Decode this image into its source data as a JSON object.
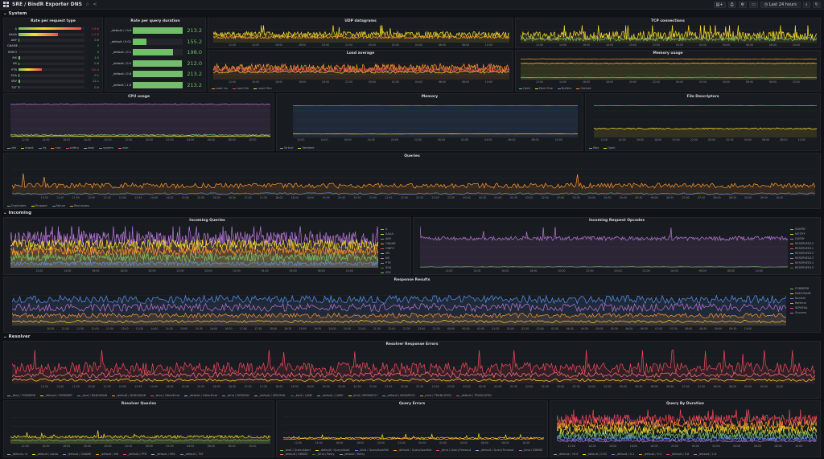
{
  "topbar": {
    "title": "SRE / BindR Exporter DNS",
    "time_range": "Last 24 hours",
    "buttons": [
      "add-panel",
      "save",
      "settings",
      "tv",
      "refresh"
    ]
  },
  "rows": {
    "system": "System",
    "incoming": "Incoming",
    "resolver": "Resolver"
  },
  "panels": {
    "rate_per_request_type": {
      "title": "Rate per request type",
      "items": [
        {
          "label": "A",
          "value": "1.6 K",
          "fraction": 0.95,
          "color": "#f2495c"
        },
        {
          "label": "AAAA",
          "value": "1.2 K",
          "fraction": 0.6,
          "color": "#f2495c"
        },
        {
          "label": "ANY",
          "value": "0.6",
          "fraction": 0.0,
          "color": "#73bf69"
        },
        {
          "label": "CNAME",
          "value": "0",
          "fraction": 0.0,
          "color": "#73bf69"
        },
        {
          "label": "HINFO",
          "value": "0",
          "fraction": 0.0,
          "color": "#73bf69"
        },
        {
          "label": "MX",
          "value": "3.5",
          "fraction": 0.02,
          "color": "#73bf69"
        },
        {
          "label": "NS",
          "value": "0.6",
          "fraction": 0.0,
          "color": "#73bf69"
        },
        {
          "label": "PTR",
          "value": "710.4",
          "fraction": 0.35,
          "color": "#f2495c"
        },
        {
          "label": "SOA",
          "value": "0.1",
          "fraction": 0.0,
          "color": "#73bf69"
        },
        {
          "label": "SRV",
          "value": "12.1",
          "fraction": 0.03,
          "color": "#73bf69"
        },
        {
          "label": "TXT",
          "value": "0.9",
          "fraction": 0.0,
          "color": "#73bf69"
        }
      ]
    },
    "rate_per_query_duration": {
      "title": "Rate per query duration",
      "items": [
        {
          "label": "_default / +Inf",
          "value": "213.2",
          "fraction": 1.0
        },
        {
          "label": "_default / 0.01",
          "value": "155.2",
          "fraction": 0.28
        },
        {
          "label": "_default / 0.1",
          "value": "198.0",
          "fraction": 0.8
        },
        {
          "label": "_default / 0.5",
          "value": "212.0",
          "fraction": 0.99
        },
        {
          "label": "_default / 0.8",
          "value": "213.2",
          "fraction": 1.0
        },
        {
          "label": "_default / 1.6",
          "value": "213.2",
          "fraction": 1.0
        }
      ]
    },
    "udp_datagrams": {
      "title": "UDP datagrams",
      "legend": []
    },
    "tcp_connections": {
      "title": "TCP connections",
      "legend": []
    },
    "load_average": {
      "title": "Load average",
      "legend": [
        "Load 1m",
        "Load 5m",
        "Load 15m"
      ]
    },
    "memory_usage": {
      "title": "Memory usage",
      "legend": [
        "Used",
        "Mem Free",
        "Buffers",
        "Cached"
      ]
    },
    "cpu_usage": {
      "title": "CPU usage",
      "legend": [
        "idle",
        "iowait",
        "irq",
        "nice",
        "softirq",
        "steal",
        "system",
        "user"
      ]
    },
    "memory": {
      "title": "Memory",
      "legend": [
        "Virtual",
        "Resident"
      ]
    },
    "file_descriptors": {
      "title": "File Descriptors",
      "legend": [
        "Max",
        "Open"
      ]
    },
    "queries": {
      "title": "Queries",
      "legend": [
        "Duplicates",
        "Dropped",
        "Failure",
        "Recursions"
      ]
    },
    "incoming_queries": {
      "title": "Incoming Queries",
      "legend": [
        "A",
        "AAAA",
        "ANY",
        "CNAME",
        "HINFO",
        "MX",
        "NS",
        "PTR",
        "SOA",
        "SRV",
        "TXT"
      ]
    },
    "incoming_request_opcodes": {
      "title": "Incoming Request Opcodes",
      "legend": [
        "IQUERY",
        "NOTIFY",
        "QUERY",
        "RESERVED10",
        "RESERVED11",
        "RESERVED12",
        "RESERVED13",
        "RESERVED14",
        "RESERVED15"
      ]
    },
    "response_results": {
      "title": "Response Results",
      "legend": [
        "FORMERR",
        "NXDOMAIN",
        "Nxrrset",
        "Referral",
        "SERVFAIL",
        "Success"
      ]
    },
    "resolver_response_errors": {
      "title": "Resolver Response Errors",
      "legend": [
        "_bind / FORMERR",
        "_default / FORMERR",
        "_bind / NXDOMAIN",
        "_default / NXDOMAIN",
        "_bind / OtherError",
        "_default / OtherError",
        "_bind / SERVFAIL",
        "_default / SERVFAIL",
        "_bind / LAME",
        "_default / LAME",
        "_bind / MISMATCH",
        "_default / MISMATCH",
        "_bind / TRUNCATED",
        "_default / TRUNCATED"
      ]
    },
    "resolver_queries": {
      "title": "Resolver Queries",
      "legend": [
        "_default / A",
        "_default / AAAA",
        "_default / CNAME",
        "_default / MX",
        "_default / PTR",
        "_default / SRV",
        "_default / TXT"
      ]
    },
    "query_errors": {
      "title": "Query Errors",
      "legend": [
        "_bind / QueryAbort",
        "_default / QueryAbort",
        "_bind / QuerySockFail",
        "_default / QuerySockFail",
        "_bind / QueryTimeout",
        "_default / QueryTimeout",
        "_bind / EDNS0",
        "_default / EDNS0",
        "_bind / Retry",
        "_default / Retry"
      ]
    },
    "query_by_duration": {
      "title": "Query By Duration",
      "legend": [
        "_default / +Inf",
        "_default / 0.01",
        "_default / 0.1",
        "_default / 0.5",
        "_default / 0.8",
        "_default / 1.6"
      ]
    }
  },
  "xticks_short": [
    "12:00",
    "14:00",
    "16:00",
    "18:00",
    "20:00",
    "22:00",
    "00:00",
    "02:00",
    "04:00",
    "06:00",
    "08:00",
    "10:00"
  ],
  "xticks_long": [
    "10:30",
    "11:00",
    "11:30",
    "12:00",
    "12:30",
    "13:00",
    "13:30",
    "14:00",
    "14:30",
    "15:00",
    "15:30",
    "16:00",
    "16:30",
    "17:00",
    "17:30",
    "18:00",
    "18:30",
    "19:00",
    "19:30",
    "20:00",
    "20:30",
    "21:00",
    "21:30",
    "22:00",
    "22:30",
    "23:00",
    "23:30",
    "00:00",
    "00:30",
    "01:00",
    "01:30",
    "02:00",
    "02:30",
    "03:00",
    "03:30",
    "04:00",
    "04:30",
    "05:00",
    "05:30",
    "06:00",
    "06:30",
    "07:00",
    "07:30",
    "08:00",
    "08:30",
    "09:00",
    "09:30",
    "10:00"
  ],
  "colors": {
    "green": "#73bf69",
    "yellow": "#fade2a",
    "orange": "#ff9830",
    "red": "#f2495c",
    "blue": "#5794f2",
    "purple": "#b877d9",
    "teal": "#37872d",
    "cyan": "#8ab8ff",
    "pink": "#ff7383"
  }
}
